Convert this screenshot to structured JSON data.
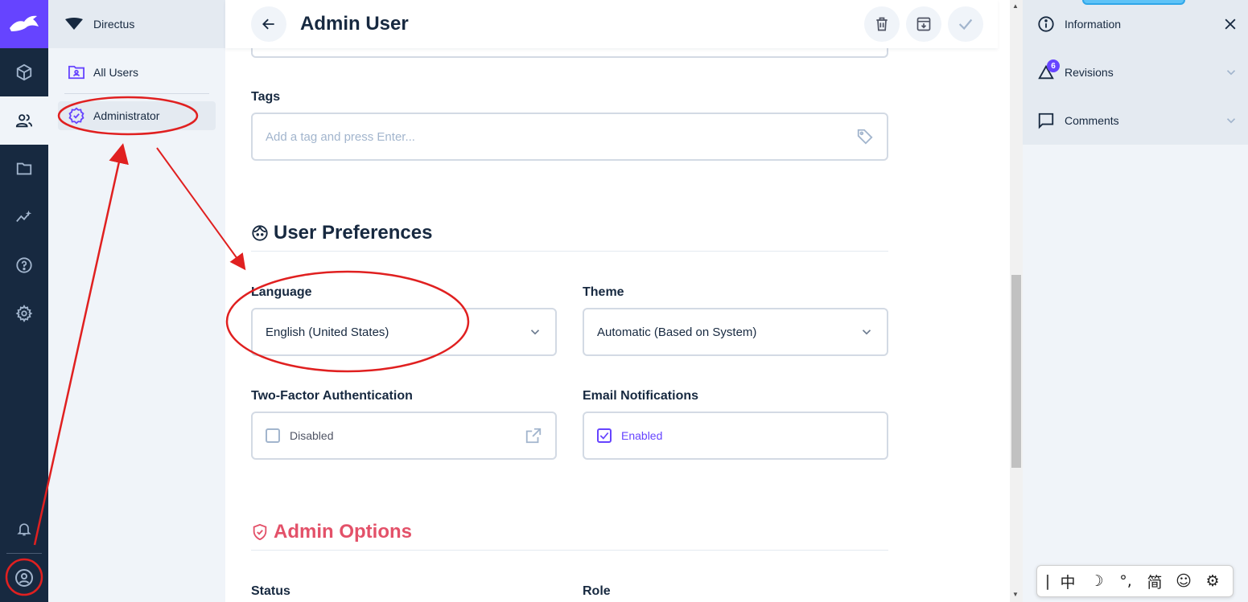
{
  "app": {
    "project_name": "Directus",
    "brand_color": "#6644ff"
  },
  "module_bar": {
    "items": [
      {
        "name": "content-module",
        "icon": "cube-icon"
      },
      {
        "name": "user-directory-module",
        "icon": "users-icon",
        "active": true
      },
      {
        "name": "files-module",
        "icon": "folder-icon"
      },
      {
        "name": "insights-module",
        "icon": "insights-icon"
      },
      {
        "name": "help-module",
        "icon": "help-icon"
      },
      {
        "name": "settings-module",
        "icon": "gear-icon"
      }
    ],
    "bottom": [
      {
        "icon": "bell-icon"
      },
      {
        "icon": "account-icon"
      }
    ]
  },
  "navigation": {
    "header": "Directus",
    "items": [
      {
        "label": "All Users",
        "icon": "folder-user-icon"
      },
      {
        "label": "Administrator",
        "icon": "verified-badge-icon",
        "active": true
      }
    ]
  },
  "header": {
    "title": "Admin User",
    "actions": [
      "delete",
      "archive",
      "save"
    ]
  },
  "form": {
    "tags": {
      "label": "Tags",
      "placeholder": "Add a tag and press Enter..."
    },
    "user_preferences": {
      "title": "User Preferences",
      "language": {
        "label": "Language",
        "value": "English (United States)"
      },
      "theme": {
        "label": "Theme",
        "value": "Automatic (Based on System)"
      },
      "two_factor": {
        "label": "Two-Factor Authentication",
        "value": "Disabled",
        "checked": false
      },
      "email_notifications": {
        "label": "Email Notifications",
        "value": "Enabled",
        "checked": true
      }
    },
    "admin_options": {
      "title": "Admin Options",
      "color": "#e35169",
      "status": {
        "label": "Status"
      },
      "role": {
        "label": "Role"
      }
    }
  },
  "sidebar": {
    "items": [
      {
        "label": "Information",
        "icon": "info-icon",
        "end_icon": "close-icon"
      },
      {
        "label": "Revisions",
        "icon": "revisions-icon",
        "badge": "6",
        "end_icon": "chevron-down-icon"
      },
      {
        "label": "Comments",
        "icon": "comment-icon",
        "end_icon": "chevron-down-icon"
      }
    ]
  },
  "ime_toolbar": {
    "items": [
      "中",
      "☽",
      "°,",
      "简",
      "☺",
      "⚙"
    ]
  }
}
